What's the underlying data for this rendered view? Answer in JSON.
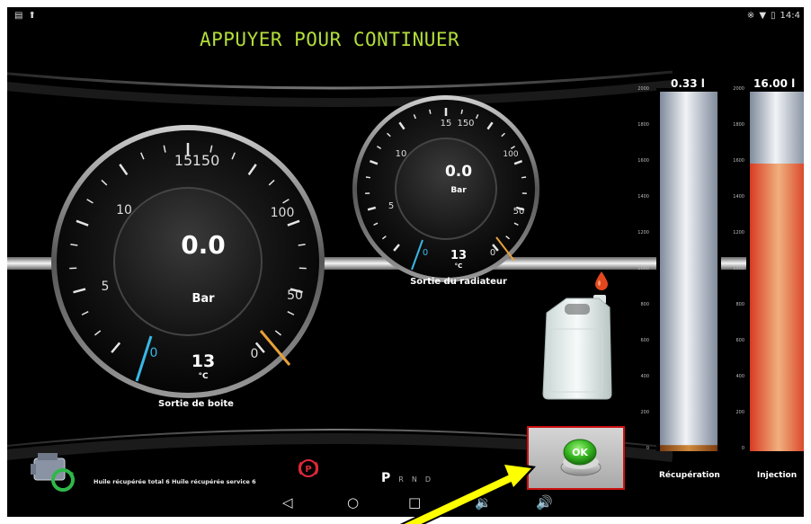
{
  "status_bar": {
    "clock": "14:4"
  },
  "header": {
    "title": "APPUYER POUR CONTINUER"
  },
  "gauges": {
    "left": {
      "pressure_value": "0.0",
      "pressure_unit": "Bar",
      "temperature_value": "13",
      "temperature_unit": "°C",
      "label": "Sortie de boite",
      "ticks": [
        "15",
        "150",
        "10",
        "100",
        "5",
        "50",
        "0",
        "0"
      ]
    },
    "right": {
      "pressure_value": "0.0",
      "pressure_unit": "Bar",
      "temperature_value": "13",
      "temperature_unit": "°C",
      "label": "Sortie du radiateur",
      "ticks": [
        "15",
        "150",
        "10",
        "100",
        "5",
        "50",
        "0",
        "0"
      ]
    }
  },
  "tanks": {
    "recuperation": {
      "top_label": "0.33 l",
      "bottom_label": "Récupération",
      "fill_fraction": 0.017,
      "fill_color": "#b8661a"
    },
    "injection": {
      "top_label": "16.00 l",
      "bottom_label": "Injection",
      "fill_fraction": 0.8,
      "fill_color": "#e84c31"
    },
    "scale": [
      "2000",
      "1800",
      "1600",
      "1400",
      "1200",
      "1000",
      "800",
      "600",
      "400",
      "200",
      "0"
    ]
  },
  "ok_button": {
    "label": "OK",
    "color": "#37b822"
  },
  "bottom_bar": {
    "oil_info": "Huile récupérée total 6 Huile récupérée service 6",
    "gear_active": "P",
    "gear_others": [
      "R",
      "N",
      "D"
    ],
    "parking_symbol": "P"
  },
  "colors": {
    "title": "#b3de3a",
    "cold_needle": "#39b7e6",
    "hot_needle": "#e8a13a",
    "arrow": "#ffff00"
  }
}
